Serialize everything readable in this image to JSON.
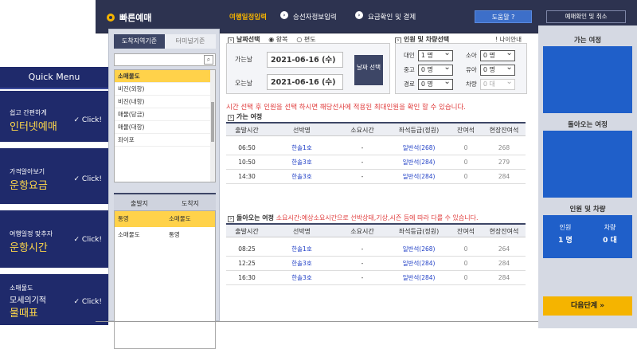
{
  "header": {
    "logo": "빠른예매",
    "steps": [
      "여행일정입력",
      "승선자정보입력",
      "요금확인 및 결제"
    ],
    "help": "도움말 ?",
    "confirm": "예매확인 및 취소"
  },
  "quick_menu": {
    "title": "Quick Menu",
    "cards": [
      {
        "small": "쉽고 간편하게",
        "big": "인터넷예매",
        "click": "✓ Click!"
      },
      {
        "small": "가격알아보기",
        "big": "운항요금",
        "click": "✓ Click!"
      },
      {
        "small": "여행일정 맞추자",
        "big": "운항시간",
        "click": "✓ Click!"
      },
      {
        "small": "소매물도",
        "small2": "모세의기적",
        "big": "물때표",
        "click": "✓ Click!"
      }
    ]
  },
  "left_panel": {
    "tabs": [
      "도착지역기준",
      "터미널기준"
    ],
    "ports": [
      "소매물도",
      "비진(외항)",
      "비진(내항)",
      "매물(당금)",
      "매물(대항)",
      "좌이포"
    ],
    "od_headers": [
      "출발지",
      "도착지"
    ],
    "od_rows": [
      {
        "from": "통영",
        "to": "소매물도"
      },
      {
        "from": "소매물도",
        "to": "통영"
      }
    ]
  },
  "date_section": {
    "title": "날짜선택",
    "round": "왕복",
    "oneway": "편도",
    "depart_label": "가는날",
    "depart_value": "2021-06-16 (수)",
    "return_label": "오는날",
    "return_value": "2021-06-16 (수)",
    "btn": "날짜 선택"
  },
  "people_section": {
    "title": "인원 및 차량선택",
    "age_guide": "! 나이안내",
    "adult": "대인",
    "adult_val": "1 명",
    "child": "소아",
    "child_val": "0 명",
    "middle": "중고",
    "middle_val": "0 명",
    "infant": "유아",
    "infant_val": "0 명",
    "senior": "경로",
    "senior_val": "0 명",
    "car": "차량",
    "car_val": "0 대"
  },
  "warning": "시간 선택 후 인원을 선택 하시면 해당선사에 적용된 최대인원을 확인 할 수 있습니다.",
  "table_headers": [
    "출발시간",
    "선박명",
    "소요시간",
    "좌석등급(정원)",
    "잔여석",
    "현장잔여석"
  ],
  "outbound": {
    "title": "가는 여정",
    "rows": [
      {
        "time": "06:50",
        "ship": "한솔1호",
        "dur": "-",
        "seat": "일반석(268)",
        "remain": "0",
        "onsite": "268"
      },
      {
        "time": "10:50",
        "ship": "한솔3호",
        "dur": "-",
        "seat": "일반석(284)",
        "remain": "0",
        "onsite": "279"
      },
      {
        "time": "14:30",
        "ship": "한솔3호",
        "dur": "-",
        "seat": "일반석(284)",
        "remain": "0",
        "onsite": "284"
      }
    ]
  },
  "inbound": {
    "title": "돌아오는 여정",
    "note": "소요시간:예상소요시간으로 선박상태,기상,시즌 등에 따라 다를 수 있습니다.",
    "rows": [
      {
        "time": "08:25",
        "ship": "한솔1호",
        "dur": "-",
        "seat": "일반석(268)",
        "remain": "0",
        "onsite": "264"
      },
      {
        "time": "12:25",
        "ship": "한솔3호",
        "dur": "-",
        "seat": "일반석(284)",
        "remain": "0",
        "onsite": "284"
      },
      {
        "time": "16:30",
        "ship": "한솔3호",
        "dur": "-",
        "seat": "일반석(284)",
        "remain": "0",
        "onsite": "284"
      }
    ]
  },
  "right_panel": {
    "outbound": "가는 여정",
    "inbound": "돌아오는 여정",
    "people_title": "인원 및 차량",
    "people_label": "인원",
    "people_val": "1 명",
    "car_label": "차량",
    "car_val": "0 대",
    "next": "다음단계 »"
  },
  "colors": {
    "navy": "#2d3350",
    "accent": "#f5b400",
    "blue": "#1f5fc9",
    "red": "#e03c3c"
  }
}
